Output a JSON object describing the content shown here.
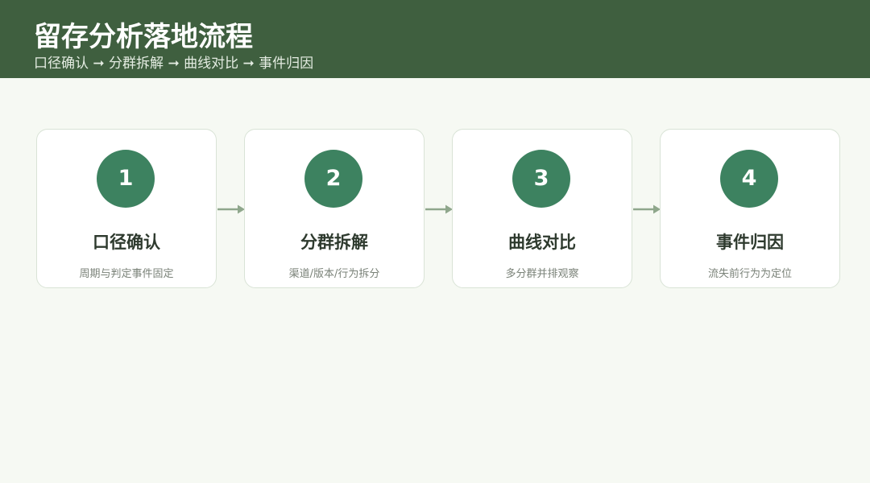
{
  "header": {
    "title": "留存分析落地流程",
    "subtitle": "口径确认 ➞ 分群拆解 ➞ 曲线对比 ➞ 事件归因"
  },
  "colors": {
    "header_bg": "#3f5f3f",
    "page_bg": "#f6f9f3",
    "circle": "#3d8260",
    "arrow": "#8fa78c"
  },
  "steps": [
    {
      "number": "1",
      "title": "口径确认",
      "desc": "周期与判定事件固定"
    },
    {
      "number": "2",
      "title": "分群拆解",
      "desc": "渠道/版本/行为拆分"
    },
    {
      "number": "3",
      "title": "曲线对比",
      "desc": "多分群并排观察"
    },
    {
      "number": "4",
      "title": "事件归因",
      "desc": "流失前行为为定位"
    }
  ]
}
